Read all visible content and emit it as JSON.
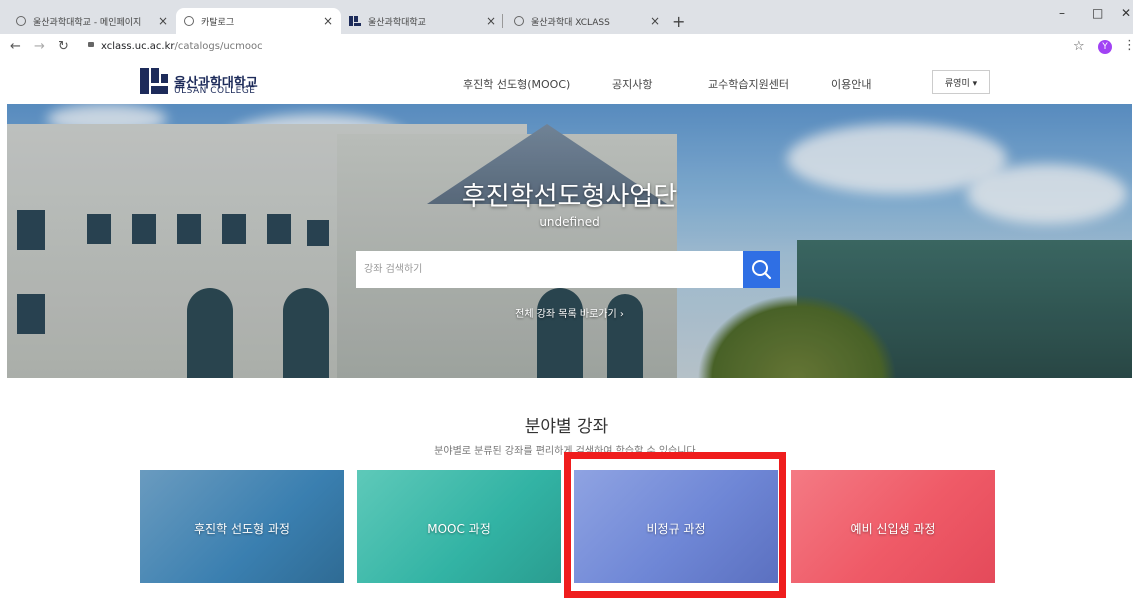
{
  "browser": {
    "tabs": [
      {
        "title": "울산과학대학교 - 메인페이지",
        "icon": "globe-icon"
      },
      {
        "title": "카탈로그",
        "icon": "globe-icon"
      },
      {
        "title": "울산과학대학교",
        "icon": "uc-logo-icon"
      },
      {
        "title": "울산과학대 XCLASS",
        "icon": "globe-icon"
      }
    ],
    "close_glyph": "×",
    "new_tab_glyph": "+",
    "url_host": "xclass.uc.ac.kr",
    "url_path": "/catalogs/ucmooc",
    "profile_initial": "Y"
  },
  "site": {
    "brand_ko": "울산과학대학교",
    "brand_en": "ULSAN COLLEGE",
    "menu": [
      "후진학 선도형(MOOC)",
      "공지사항",
      "교수학습지원센터",
      "이용안내"
    ],
    "user_name": "류영미 ▾"
  },
  "hero": {
    "title": "후진학선도형사업단",
    "subtitle": "undefined",
    "search_placeholder": "강좌 검색하기",
    "all_courses_link": "전체 강좌 목록 바로가기 ›"
  },
  "categories": {
    "title": "분야별 강좌",
    "subtitle": "분야별로 분류된 강좌를 편리하게 검색하여 학습할 수 있습니다.",
    "cards": [
      {
        "label": "후진학 선도형 과정",
        "color": "#3a7fb0"
      },
      {
        "label": "MOOC 과정",
        "color": "#32b3a4"
      },
      {
        "label": "비정규 과정",
        "color": "#6f87d6"
      },
      {
        "label": "예비 신입생 과정",
        "color": "#ef5a67"
      }
    ],
    "highlighted_card": "비정규 과정"
  },
  "colors": {
    "search_button": "#2f6fe4",
    "highlight_border": "#ef1d1d",
    "brand_navy": "#1d2b5a"
  }
}
